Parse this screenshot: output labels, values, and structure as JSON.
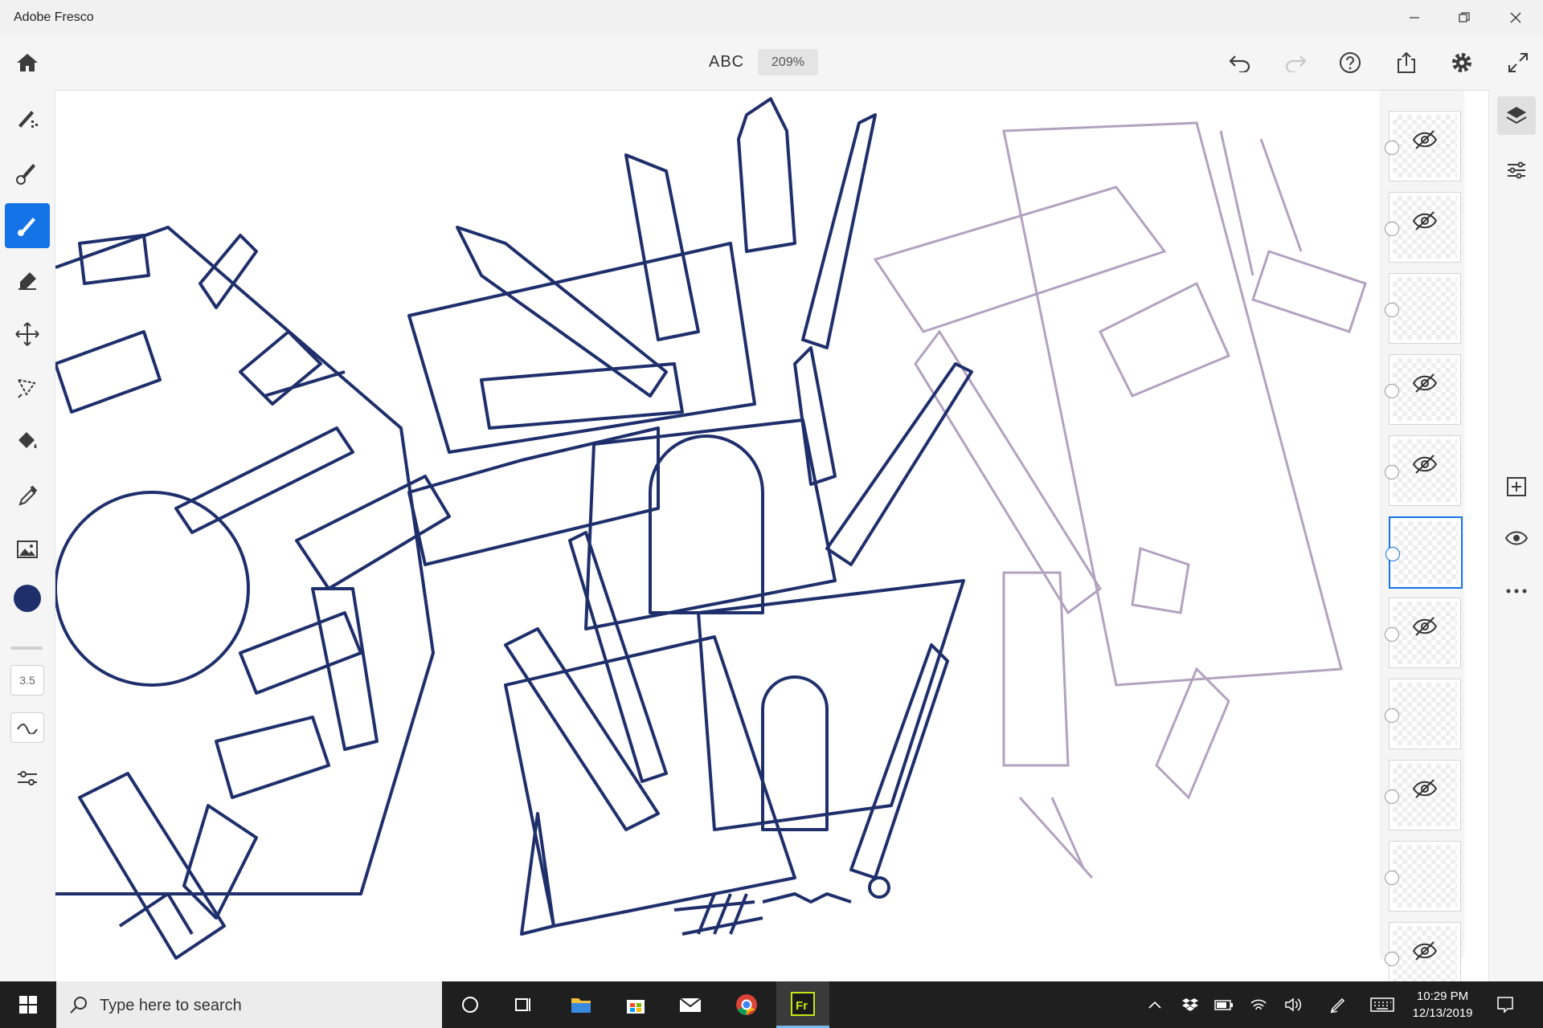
{
  "window": {
    "title": "Adobe Fresco"
  },
  "toolbar": {
    "document_title": "ABC",
    "zoom": "209%"
  },
  "left_rail": {
    "brush_size": "3.5",
    "color": "#1f2f6b"
  },
  "layers": [
    {
      "visible": false
    },
    {
      "visible": false
    },
    {
      "visible": true
    },
    {
      "visible": false
    },
    {
      "visible": false
    },
    {
      "visible": true,
      "selected": true
    },
    {
      "visible": false
    },
    {
      "visible": true
    },
    {
      "visible": false
    },
    {
      "visible": true
    },
    {
      "visible": false
    }
  ],
  "taskbar": {
    "search_placeholder": "Type here to search",
    "time": "10:29 PM",
    "date": "12/13/2019"
  },
  "colors": {
    "accent": "#1473e6",
    "ink": "#1f2f6b",
    "sketch": "#a08cb0"
  }
}
